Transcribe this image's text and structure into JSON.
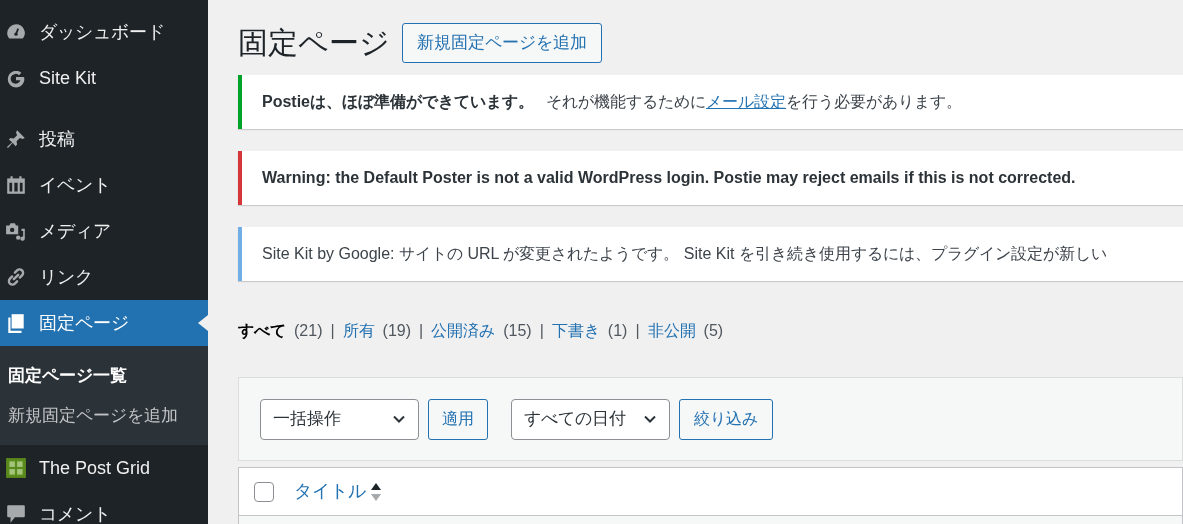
{
  "sidebar": {
    "items": [
      {
        "label": "ダッシュボード",
        "selected": false
      },
      {
        "label": "Site Kit",
        "selected": false
      },
      {
        "label": "投稿",
        "selected": false
      },
      {
        "label": "イベント",
        "selected": false
      },
      {
        "label": "メディア",
        "selected": false
      },
      {
        "label": "リンク",
        "selected": false
      },
      {
        "label": "固定ページ",
        "selected": true,
        "children": [
          {
            "label": "固定ページ一覧",
            "selected": true
          },
          {
            "label": "新規固定ページを追加",
            "selected": false
          }
        ]
      },
      {
        "label": "The Post Grid",
        "selected": false
      },
      {
        "label": "コメント",
        "selected": false
      }
    ]
  },
  "page": {
    "title": "固定ページ",
    "add_button": "新規固定ページを追加"
  },
  "notices": [
    {
      "kind": "success",
      "strong": "Postieは、ほぼ準備ができています。",
      "before": "それが機能するために",
      "link": "メール設定",
      "after": "を行う必要があります。"
    },
    {
      "kind": "error",
      "strong": "Warning: the Default Poster is not a valid WordPress login. Postie may reject emails if this is not corrected."
    },
    {
      "kind": "info",
      "before": "Site Kit by Google: サイトの URL が変更されたようです。 Site Kit を引き続き使用するには、プラグイン設定が新しい"
    }
  ],
  "filters": [
    {
      "label": "すべて",
      "count": "(21)",
      "selected": true
    },
    {
      "separator": "|",
      "label": "所有",
      "count": "(19)",
      "selected": false
    },
    {
      "separator": "|",
      "label": "公開済み",
      "count": "(15)",
      "selected": false
    },
    {
      "separator": "|",
      "label": "下書き",
      "count": "(1)",
      "selected": false
    },
    {
      "separator": "|",
      "label": "非公開",
      "count": "(5)",
      "selected": false
    }
  ],
  "toolbar": {
    "bulk_select": "一括操作",
    "apply": "適用",
    "date_select": "すべての日付",
    "filter": "絞り込み"
  },
  "table": {
    "columns": [
      {
        "label": "タイトル"
      }
    ],
    "select_all_checked": false
  }
}
